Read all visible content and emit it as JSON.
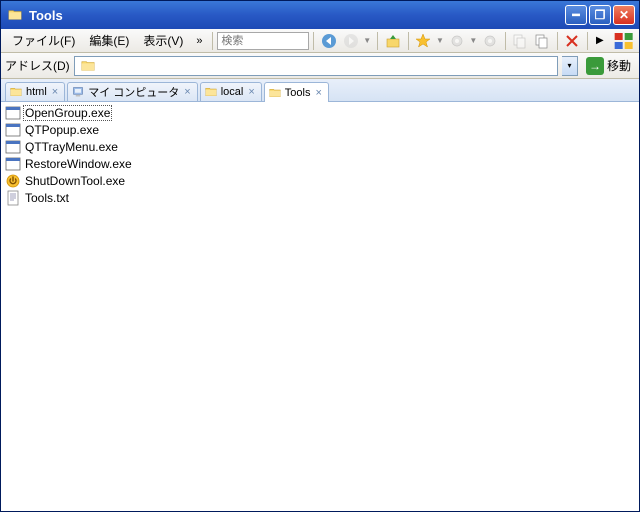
{
  "title": "Tools",
  "menus": {
    "file": "ファイル(F)",
    "edit": "編集(E)",
    "view": "表示(V)"
  },
  "search": {
    "placeholder": "検索"
  },
  "address": {
    "label": "アドレス(D)",
    "go": "移動"
  },
  "tabs": [
    {
      "label": "html",
      "icon": "folder"
    },
    {
      "label": "マイ コンピュータ",
      "icon": "computer"
    },
    {
      "label": "local",
      "icon": "folder"
    },
    {
      "label": "Tools",
      "icon": "folder",
      "active": true
    }
  ],
  "files": [
    {
      "name": "OpenGroup.exe",
      "icon": "app",
      "selected": true
    },
    {
      "name": "QTPopup.exe",
      "icon": "app"
    },
    {
      "name": "QTTrayMenu.exe",
      "icon": "app"
    },
    {
      "name": "RestoreWindow.exe",
      "icon": "app"
    },
    {
      "name": "ShutDownTool.exe",
      "icon": "shutdown"
    },
    {
      "name": "Tools.txt",
      "icon": "txt"
    }
  ]
}
